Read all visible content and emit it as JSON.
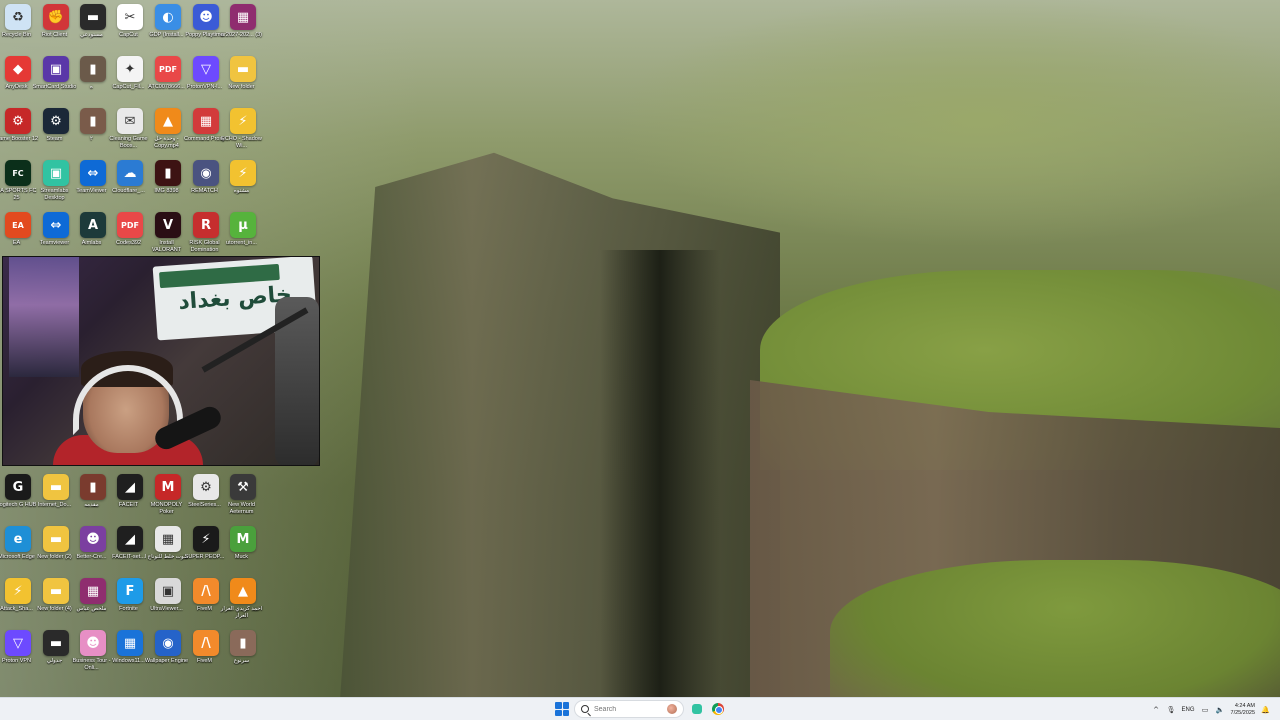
{
  "desktop": {
    "icons": [
      {
        "label": "Recycle Bin",
        "icon": "recycle-bin-icon",
        "color": "#cfe3f5",
        "glyph": "♻",
        "col": 0,
        "row": 0
      },
      {
        "label": "Riot Client",
        "icon": "riot-client-icon",
        "color": "#d13639",
        "glyph": "✊",
        "col": 1,
        "row": 0
      },
      {
        "label": "مستودعي",
        "icon": "folder-icon",
        "color": "#2a2a2a",
        "glyph": "▬",
        "col": 2,
        "row": 0
      },
      {
        "label": "CapCut",
        "icon": "capcut-icon",
        "color": "#ffffff",
        "glyph": "✂",
        "col": 3,
        "row": 0
      },
      {
        "label": "GDP (Install...",
        "icon": "gdp-icon",
        "color": "#3a8ee6",
        "glyph": "◐",
        "col": 4,
        "row": 0
      },
      {
        "label": "Poppy Playtime",
        "icon": "poppy-playtime-icon",
        "color": "#3b5bd6",
        "glyph": "☻",
        "col": 5,
        "row": 0
      },
      {
        "label": "ar2027-202... (3)",
        "icon": "winrar-icon",
        "color": "#8f2d6f",
        "glyph": "▦",
        "col": 6,
        "row": 0
      },
      {
        "label": "AnyDesk",
        "icon": "anydesk-icon",
        "color": "#e53935",
        "glyph": "◆",
        "col": 0,
        "row": 1
      },
      {
        "label": "SmartCard Studio",
        "icon": "smartcard-icon",
        "color": "#5a37a8",
        "glyph": "▣",
        "col": 1,
        "row": 1
      },
      {
        "label": "ه",
        "icon": "image-file-icon",
        "color": "#6b5a4a",
        "glyph": "▮",
        "col": 2,
        "row": 1
      },
      {
        "label": "CapCut_Fil...",
        "icon": "capcut-installer-icon",
        "color": "#f4f4f4",
        "glyph": "✦",
        "col": 3,
        "row": 1
      },
      {
        "label": "ATC0078666...",
        "icon": "pdf-icon",
        "color": "#e94848",
        "glyph": "PDF",
        "col": 4,
        "row": 1
      },
      {
        "label": "ProtonVPN-l...",
        "icon": "protonvpn-icon",
        "color": "#6d4aff",
        "glyph": "▽",
        "col": 5,
        "row": 1
      },
      {
        "label": "New folder",
        "icon": "folder-icon",
        "color": "#f0c440",
        "glyph": "▬",
        "col": 6,
        "row": 1
      },
      {
        "label": "Game Booster 12",
        "icon": "game-booster-icon",
        "color": "#c62828",
        "glyph": "⚙",
        "col": 0,
        "row": 2
      },
      {
        "label": "Steam",
        "icon": "steam-icon",
        "color": "#1b2838",
        "glyph": "⚙",
        "col": 1,
        "row": 2
      },
      {
        "label": "٢",
        "icon": "image-file-icon",
        "color": "#7a5b4a",
        "glyph": "▮",
        "col": 2,
        "row": 2
      },
      {
        "label": "Cleaning Game Boos...",
        "icon": "cleaning-icon",
        "color": "#e9e9e9",
        "glyph": "✉",
        "col": 3,
        "row": 2
      },
      {
        "label": "وحدة حل - Copy.mp4",
        "icon": "vlc-icon",
        "color": "#f08a1a",
        "glyph": "▲",
        "col": 4,
        "row": 2
      },
      {
        "label": "Command Proxy",
        "icon": "command-icon",
        "color": "#d23b3b",
        "glyph": "▦",
        "col": 5,
        "row": 2
      },
      {
        "label": "ECHO - Shadow Wi...",
        "icon": "attack-shark-icon",
        "color": "#f2c230",
        "glyph": "⚡",
        "col": 6,
        "row": 2
      },
      {
        "label": "EA SPORTS FC 25",
        "icon": "ea-fc-icon",
        "color": "#0b2f1a",
        "glyph": "FC",
        "col": 0,
        "row": 3
      },
      {
        "label": "Streamlabs Desktop",
        "icon": "streamlabs-icon",
        "color": "#31c3a2",
        "glyph": "▣",
        "col": 1,
        "row": 3
      },
      {
        "label": "TeamViewer",
        "icon": "teamviewer-icon",
        "color": "#0e6ad6",
        "glyph": "⇔",
        "col": 2,
        "row": 3
      },
      {
        "label": "Cloudflare_...",
        "icon": "cloudflare-icon",
        "color": "#2b7bd3",
        "glyph": "☁",
        "col": 3,
        "row": 3
      },
      {
        "label": "IMG 8398",
        "icon": "image-file-icon",
        "color": "#3d1313",
        "glyph": "▮",
        "col": 4,
        "row": 3
      },
      {
        "label": "REMATCH",
        "icon": "rematch-icon",
        "color": "#4a5380",
        "glyph": "◉",
        "col": 5,
        "row": 3
      },
      {
        "label": "مشتوه",
        "icon": "attack-shark-icon",
        "color": "#f2c230",
        "glyph": "⚡",
        "col": 6,
        "row": 3
      },
      {
        "label": "EA",
        "icon": "ea-icon",
        "color": "#e24a1f",
        "glyph": "EA",
        "col": 0,
        "row": 4
      },
      {
        "label": "Teamviewer",
        "icon": "teamviewer-icon",
        "color": "#0e6ad6",
        "glyph": "⇔",
        "col": 1,
        "row": 4
      },
      {
        "label": "Aimlabs",
        "icon": "aimlabs-icon",
        "color": "#1d3a3a",
        "glyph": "A",
        "col": 2,
        "row": 4
      },
      {
        "label": "Codes392",
        "icon": "pdf-icon",
        "color": "#e94848",
        "glyph": "PDF",
        "col": 3,
        "row": 4
      },
      {
        "label": "Install VALORANT",
        "icon": "valorant-icon",
        "color": "#2a0e14",
        "glyph": "V",
        "col": 4,
        "row": 4
      },
      {
        "label": "RISK Global Domination",
        "icon": "risk-icon",
        "color": "#c62e2e",
        "glyph": "R",
        "col": 5,
        "row": 4
      },
      {
        "label": "utorrent_in...",
        "icon": "utorrent-icon",
        "color": "#56b33c",
        "glyph": "μ",
        "col": 6,
        "row": 4
      },
      {
        "label": "Logitech G HUB",
        "icon": "logitech-icon",
        "color": "#1a1a1a",
        "glyph": "G",
        "col": 0,
        "row": 5
      },
      {
        "label": "Internet_Do...",
        "icon": "folder-icon",
        "color": "#f0c440",
        "glyph": "▬",
        "col": 1,
        "row": 5
      },
      {
        "label": "مقدمه",
        "icon": "video-file-icon",
        "color": "#7a3b2e",
        "glyph": "▮",
        "col": 2,
        "row": 5
      },
      {
        "label": "FACEIT",
        "icon": "faceit-icon",
        "color": "#1f1f1f",
        "glyph": "◢",
        "col": 3,
        "row": 5
      },
      {
        "label": "MONOPOLY Poker",
        "icon": "monopoly-icon",
        "color": "#c62828",
        "glyph": "M",
        "col": 4,
        "row": 5
      },
      {
        "label": "SteelSeries...",
        "icon": "steelseries-icon",
        "color": "#e8e8e8",
        "glyph": "⚙",
        "col": 5,
        "row": 5
      },
      {
        "label": "New World Aeternum",
        "icon": "new-world-icon",
        "color": "#3a3a3a",
        "glyph": "⚒",
        "col": 6,
        "row": 5
      },
      {
        "label": "Microsoft Edge",
        "icon": "edge-icon",
        "color": "#1e8fd6",
        "glyph": "e",
        "col": 0,
        "row": 6
      },
      {
        "label": "New folder (2)",
        "icon": "folder-icon",
        "color": "#f0c440",
        "glyph": "▬",
        "col": 1,
        "row": 6
      },
      {
        "label": "Better-Cre...",
        "icon": "bettercrewlink-icon",
        "color": "#7b3fa0",
        "glyph": "☻",
        "col": 2,
        "row": 6
      },
      {
        "label": "FACEIT-set...",
        "icon": "faceit-icon",
        "color": "#1f1f1f",
        "glyph": "◢",
        "col": 3,
        "row": 6
      },
      {
        "label": "صوت خلط للتوناج ا",
        "icon": "audio-file-icon",
        "color": "#e8e8e8",
        "glyph": "▦",
        "col": 4,
        "row": 6
      },
      {
        "label": "SUPER PEOP...",
        "icon": "super-people-icon",
        "color": "#1a1a1a",
        "glyph": "⚡",
        "col": 5,
        "row": 6
      },
      {
        "label": "Muck",
        "icon": "muck-icon",
        "color": "#4aa03c",
        "glyph": "M",
        "col": 6,
        "row": 6
      },
      {
        "label": "Attack_Sha...",
        "icon": "attack-shark-icon",
        "color": "#f2c230",
        "glyph": "⚡",
        "col": 0,
        "row": 7
      },
      {
        "label": "New folder (4)",
        "icon": "folder-icon",
        "color": "#f0c440",
        "glyph": "▬",
        "col": 1,
        "row": 7
      },
      {
        "label": "ملخص عباس",
        "icon": "winrar-icon",
        "color": "#8f2d6f",
        "glyph": "▦",
        "col": 2,
        "row": 7
      },
      {
        "label": "Fortnite",
        "icon": "fortnite-icon",
        "color": "#1e9be8",
        "glyph": "F",
        "col": 3,
        "row": 7
      },
      {
        "label": "UltraViewer...",
        "icon": "ultraviewer-icon",
        "color": "#d9d9d9",
        "glyph": "▣",
        "col": 4,
        "row": 7
      },
      {
        "label": "FiveM",
        "icon": "fivem-icon",
        "color": "#f28a2b",
        "glyph": "/\\",
        "col": 5,
        "row": 7
      },
      {
        "label": "أحمد كريدي العزار العزار",
        "icon": "vlc-icon",
        "color": "#f08a1a",
        "glyph": "▲",
        "col": 6,
        "row": 7
      },
      {
        "label": "Proton VPN",
        "icon": "protonvpn-icon",
        "color": "#6d4aff",
        "glyph": "▽",
        "col": 0,
        "row": 8
      },
      {
        "label": "جدولي",
        "icon": "folder-icon",
        "color": "#2a2a2a",
        "glyph": "▬",
        "col": 1,
        "row": 8
      },
      {
        "label": "Business Tour - Onli...",
        "icon": "business-tour-icon",
        "color": "#e78fc5",
        "glyph": "☻",
        "col": 2,
        "row": 8
      },
      {
        "label": "Windows11...",
        "icon": "windows-icon",
        "color": "#1a73d9",
        "glyph": "▦",
        "col": 3,
        "row": 8
      },
      {
        "label": "Wallpaper Engine",
        "icon": "wallpaper-engine-icon",
        "color": "#2563c9",
        "glyph": "◉",
        "col": 4,
        "row": 8
      },
      {
        "label": "FiveM",
        "icon": "fivem-icon",
        "color": "#f28a2b",
        "glyph": "/\\",
        "col": 5,
        "row": 8
      },
      {
        "label": "سرنوع",
        "icon": "image-file-icon",
        "color": "#8a6a5a",
        "glyph": "▮",
        "col": 6,
        "row": 8
      }
    ]
  },
  "webcam": {
    "sign_text": "خاص بغداد"
  },
  "taskbar": {
    "search_placeholder": "Search",
    "apps": [
      "streamlabs-icon",
      "chrome-icon"
    ],
    "tray": {
      "chevron": "^",
      "language": "ENG",
      "time": "4:24 AM",
      "date": "7/25/2025"
    }
  }
}
